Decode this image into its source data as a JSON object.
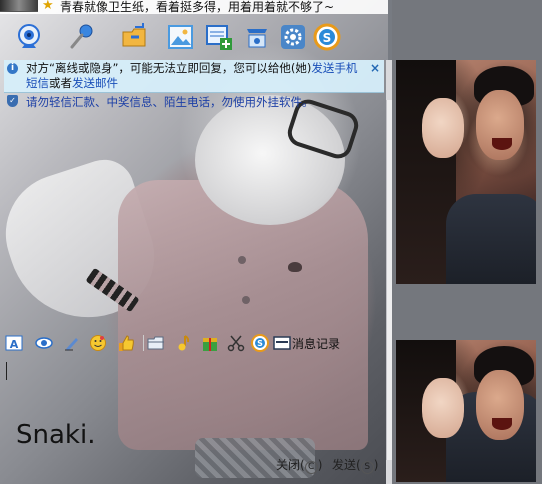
{
  "top_status": {
    "signature": "青春就像卫生纸，看着挺多得，用着用着就不够了~"
  },
  "toolbar": {
    "buttons": [
      {
        "name": "video-call-icon",
        "color": "#2b6fd6"
      },
      {
        "name": "voice-call-icon",
        "color": "#3a86e0"
      },
      {
        "name": "send-file-icon",
        "color": "#e8a020"
      },
      {
        "name": "image-icon",
        "color": "#4a9ae0"
      },
      {
        "name": "add-app-icon",
        "color": "#2f9a3a"
      },
      {
        "name": "remote-assist-icon",
        "color": "#2a6ec8"
      },
      {
        "name": "settings-icon",
        "color": "#4a86c8"
      },
      {
        "name": "qq-security-icon",
        "color": "#2a8ad8"
      }
    ]
  },
  "notice": {
    "text_pre": "对方“离线或隐身”，可能无法立即回复，您可以给他(她)",
    "link_sms": "发送手机短信",
    "text_mid": "或者",
    "link_mail": "发送邮件",
    "close": "×"
  },
  "warning": {
    "text": "请勿轻信汇款、中奖信息、陌生电话，勿使用外挂软件。"
  },
  "input_toolbar": {
    "icons": [
      "font-icon",
      "eye-icon",
      "edit-icon",
      "emoji-icon",
      "thumb-icon",
      "folder-icon",
      "music-icon",
      "gift-icon",
      "scissors-icon",
      "security-icon",
      "screen-icon"
    ],
    "history_label": "消息记录"
  },
  "input": {
    "signature_art": "Snaki."
  },
  "actions": {
    "close_label": "关闭(",
    "close_key": "C",
    "send_label": "发送(",
    "send_key": "S"
  }
}
